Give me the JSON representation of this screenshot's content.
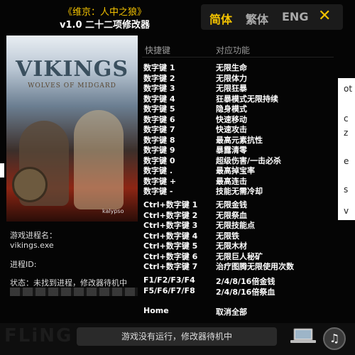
{
  "header": {
    "game_title": "《维京：人中之狼》",
    "version": "v1.0 二十二项修改器"
  },
  "languages": {
    "simplified": "简体",
    "traditional": "繁体",
    "english": "ENG"
  },
  "cover": {
    "logo": "VIKINGS",
    "subtitle": "WOLVES OF MIDGARD",
    "publisher": "kalypso"
  },
  "info": {
    "process_name_label": "游戏进程名：",
    "process_name_value": "vikings.exe",
    "process_id_label": "进程ID:",
    "status_label": "状态：未找到进程，修改器待机中"
  },
  "hotkeys": {
    "col_key": "快捷键",
    "col_func": "对应功能",
    "numpad": [
      {
        "key": "数字键 1",
        "func": "无限生命"
      },
      {
        "key": "数字键 2",
        "func": "无限体力"
      },
      {
        "key": "数字键 3",
        "func": "无限狂暴"
      },
      {
        "key": "数字键 4",
        "func": "狂暴模式无限持续"
      },
      {
        "key": "数字键 5",
        "func": "隐身模式"
      },
      {
        "key": "数字键 6",
        "func": "快速移动"
      },
      {
        "key": "数字键 7",
        "func": "快速攻击"
      },
      {
        "key": "数字键 8",
        "func": "最高元素抗性"
      },
      {
        "key": "数字键 9",
        "func": "暴露清零"
      },
      {
        "key": "数字键 0",
        "func": "超级伤害/一击必杀"
      },
      {
        "key": "数字键 .",
        "func": "最高掉宝率"
      },
      {
        "key": "数字键 +",
        "func": "最高连击"
      },
      {
        "key": "数字键 -",
        "func": "技能无需冷却"
      }
    ],
    "ctrl": [
      {
        "key": "Ctrl+数字键 1",
        "func": "无限金钱"
      },
      {
        "key": "Ctrl+数字键 2",
        "func": "无限祭血"
      },
      {
        "key": "Ctrl+数字键 3",
        "func": "无限技能点"
      },
      {
        "key": "Ctrl+数字键 4",
        "func": "无限铁"
      },
      {
        "key": "Ctrl+数字键 5",
        "func": "无限木材"
      },
      {
        "key": "Ctrl+数字键 6",
        "func": "无限巨人秘矿"
      },
      {
        "key": "Ctrl+数字键 7",
        "func": "治疗图腾无限使用次数"
      }
    ],
    "function_keys": [
      {
        "key": "F1/F2/F3/F4",
        "func": "2/4/8/16倍金钱"
      },
      {
        "key": "F5/F6/F7/F8",
        "func": "2/4/8/16倍祭血"
      }
    ],
    "home": {
      "key": "Home",
      "func": "取消全部"
    }
  },
  "footer": {
    "brand_watermark": "FLiNG",
    "status_bar": "游戏没有运行，修改器待机中"
  },
  "background_window": {
    "fragments": [
      "ot",
      "c",
      "z",
      "e",
      "s",
      "v"
    ]
  },
  "colors": {
    "accent": "#f3c200",
    "background": "#050505"
  }
}
